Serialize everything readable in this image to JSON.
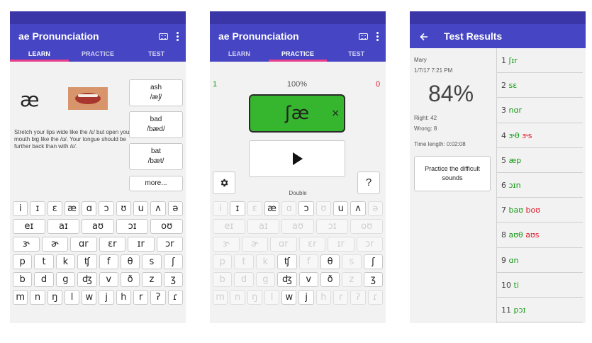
{
  "learn": {
    "title": "ae Pronunciation",
    "tabs": [
      "LEARN",
      "PRACTICE",
      "TEST"
    ],
    "symbol": "æ",
    "description": "Stretch your lips wide like the /ε/ but open your mouth big like the /ɑ/. Your tongue should be further back than with /ε/.",
    "words": [
      {
        "word": "ash",
        "ipa": "/æʃ/"
      },
      {
        "word": "bad",
        "ipa": "/bæd/"
      },
      {
        "word": "bat",
        "ipa": "/bæt/"
      }
    ],
    "more_label": "more...",
    "keyboard": [
      [
        "i",
        "ɪ",
        "ε",
        "æ",
        "ɑ",
        "ɔ",
        "ʊ",
        "u",
        "ʌ",
        "ə"
      ],
      [
        "eɪ",
        "aɪ",
        "aʊ",
        "ɔɪ",
        "oʊ"
      ],
      [
        "ɝ",
        "ɚ",
        "ɑr",
        "εr",
        "ɪr",
        "ɔr"
      ],
      [
        "p",
        "t",
        "k",
        "ʧ",
        "f",
        "θ",
        "s",
        "ʃ"
      ],
      [
        "b",
        "d",
        "g",
        "ʤ",
        "v",
        "ð",
        "z",
        "ʒ"
      ],
      [
        "m",
        "n",
        "ŋ",
        "l",
        "w",
        "j",
        "h",
        "r",
        "ʔ",
        "ɾ"
      ]
    ]
  },
  "practice": {
    "title": "ae Pronunciation",
    "tabs": [
      "LEARN",
      "PRACTICE",
      "TEST"
    ],
    "correct_count": "1",
    "progress": "100%",
    "wrong_count": "0",
    "target_sound": "ʃæ",
    "clear_icon": "×",
    "help_label": "?",
    "mode_label": "Double",
    "enabled_keys": [
      "ɪ",
      "æ",
      "ɔ",
      "u",
      "ʌ",
      "ʧ",
      "θ",
      "ʃ",
      "ʤ",
      "v",
      "ð",
      "ʒ",
      "w",
      "j"
    ]
  },
  "results": {
    "title": "Test Results",
    "name": "Mary",
    "datetime": "1/7/17 7:21 PM",
    "percent": "84%",
    "right": "Right: 42",
    "wrong": "Wrong: 8",
    "time_length": "Time length: 0:02:08",
    "practice_button": "Practice the difficult sounds",
    "items": [
      {
        "num": "1",
        "parts": [
          {
            "text": "ʃɪr",
            "status": "ok"
          }
        ]
      },
      {
        "num": "2",
        "parts": [
          {
            "text": "sε",
            "status": "ok"
          }
        ]
      },
      {
        "num": "3",
        "parts": [
          {
            "text": "nɑr",
            "status": "ok"
          }
        ]
      },
      {
        "num": "4",
        "parts": [
          {
            "text": "ɝθ",
            "status": "ok"
          },
          {
            "text": "ɝs",
            "status": "bad"
          }
        ]
      },
      {
        "num": "5",
        "parts": [
          {
            "text": "æp",
            "status": "ok"
          }
        ]
      },
      {
        "num": "6",
        "parts": [
          {
            "text": "ɔɪn",
            "status": "ok"
          }
        ]
      },
      {
        "num": "7",
        "parts": [
          {
            "text": "baʊ",
            "status": "ok"
          },
          {
            "text": "boʊ",
            "status": "bad"
          }
        ]
      },
      {
        "num": "8",
        "parts": [
          {
            "text": "aʊθ",
            "status": "ok"
          },
          {
            "text": "aʊs",
            "status": "bad"
          }
        ]
      },
      {
        "num": "9",
        "parts": [
          {
            "text": "ɑn",
            "status": "ok"
          }
        ]
      },
      {
        "num": "10",
        "parts": [
          {
            "text": "ti",
            "status": "ok"
          }
        ]
      },
      {
        "num": "11",
        "parts": [
          {
            "text": "pɔɪ",
            "status": "ok"
          }
        ]
      }
    ]
  },
  "colors": {
    "primary": "#4646c4",
    "accent": "#e83e8c",
    "correct": "#36b52e",
    "wrong": "#e0182a"
  },
  "icons": [
    "keyboard-icon",
    "overflow-menu-icon",
    "settings-gear-icon",
    "play-icon",
    "back-arrow-icon",
    "close-icon",
    "mouth-image"
  ]
}
